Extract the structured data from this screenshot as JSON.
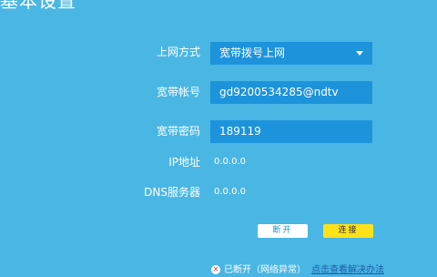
{
  "header": {
    "title": "基本设置"
  },
  "form": {
    "connection_type": {
      "label": "上网方式",
      "value": "宽带拨号上网"
    },
    "account": {
      "label": "宽带帐号",
      "value": "gd9200534285@ndtv"
    },
    "password": {
      "label": "宽带密码",
      "value": "189119"
    },
    "ip": {
      "label": "IP地址",
      "value": "0.0.0.0"
    },
    "dns": {
      "label": "DNS服务器",
      "value": "0.0.0.0"
    }
  },
  "actions": {
    "disconnect_label": "断开",
    "connect_label": "连接"
  },
  "status": {
    "icon": "error-icon",
    "text": "已断开（网络异常）",
    "help_link": "点击查看解决办法"
  },
  "colors": {
    "background": "#4ab6e4",
    "field": "#1d93dc",
    "connect_button": "#ffe11a"
  }
}
